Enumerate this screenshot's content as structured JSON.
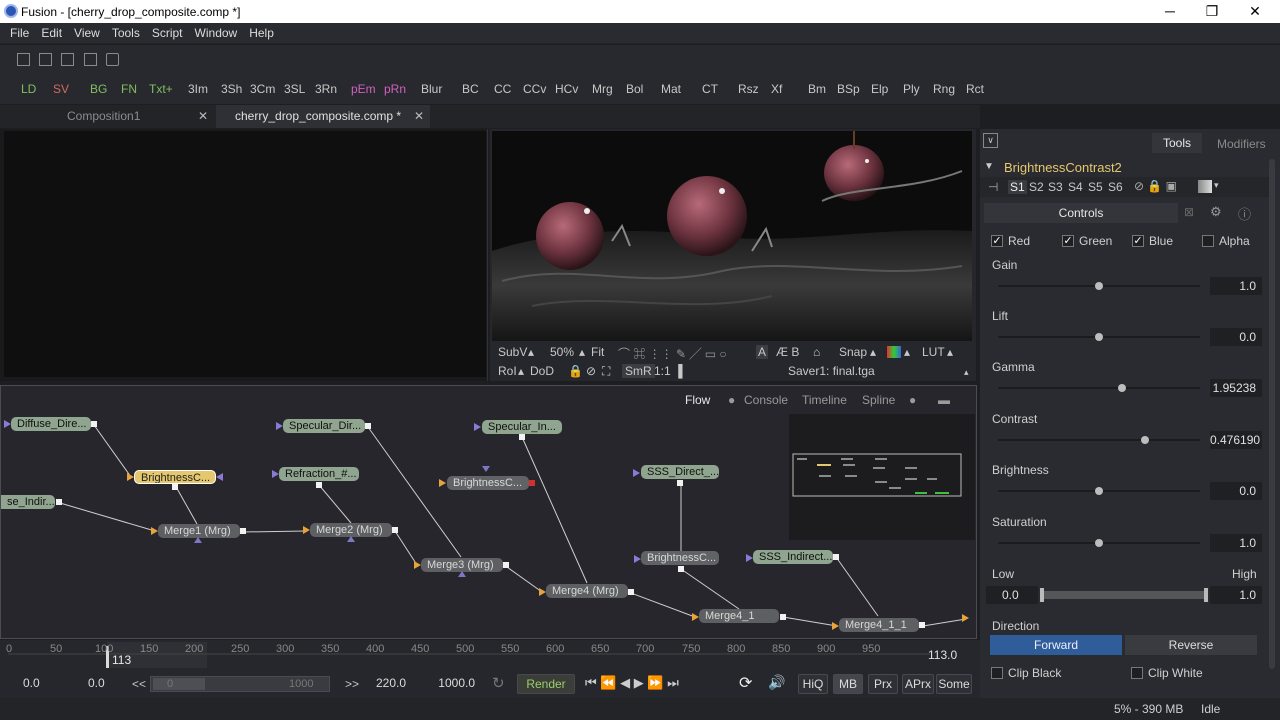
{
  "window": {
    "app": "Fusion",
    "title": "Fusion - [cherry_drop_composite.comp *]",
    "minimize": "─",
    "maximize": "❐",
    "close": "✕"
  },
  "menu": [
    "File",
    "Edit",
    "View",
    "Tools",
    "Script",
    "Window",
    "Help"
  ],
  "toolbar": {
    "items": [
      {
        "label": "LD",
        "color": "#7fbf5f"
      },
      {
        "label": "SV",
        "color": "#d06a5a"
      },
      {
        "label": "BG",
        "color": "#7fbf5f"
      },
      {
        "label": "FN",
        "color": "#7fbf5f"
      },
      {
        "label": "Txt+",
        "color": "#7fbf5f"
      },
      {
        "label": "3Im",
        "color": "#c8c8c8"
      },
      {
        "label": "3Sh",
        "color": "#c8c8c8"
      },
      {
        "label": "3Cm",
        "color": "#c8c8c8"
      },
      {
        "label": "3SL",
        "color": "#c8c8c8"
      },
      {
        "label": "3Rn",
        "color": "#c8c8c8"
      },
      {
        "label": "pEm",
        "color": "#d060c0"
      },
      {
        "label": "pRn",
        "color": "#d060c0"
      },
      {
        "label": "Blur",
        "color": "#c8c8c8"
      },
      {
        "label": "BC",
        "color": "#c8c8c8"
      },
      {
        "label": "CC",
        "color": "#c8c8c8"
      },
      {
        "label": "CCv",
        "color": "#c8c8c8"
      },
      {
        "label": "HCv",
        "color": "#c8c8c8"
      },
      {
        "label": "Mrg",
        "color": "#c8c8c8"
      },
      {
        "label": "Bol",
        "color": "#c8c8c8"
      },
      {
        "label": "Mat",
        "color": "#c8c8c8"
      },
      {
        "label": "CT",
        "color": "#c8c8c8"
      },
      {
        "label": "Rsz",
        "color": "#c8c8c8"
      },
      {
        "label": "Xf",
        "color": "#c8c8c8"
      },
      {
        "label": "Bm",
        "color": "#c8c8c8"
      },
      {
        "label": "BSp",
        "color": "#c8c8c8"
      },
      {
        "label": "Elp",
        "color": "#c8c8c8"
      },
      {
        "label": "Ply",
        "color": "#c8c8c8"
      },
      {
        "label": "Rng",
        "color": "#c8c8c8"
      },
      {
        "label": "Rct",
        "color": "#c8c8c8"
      }
    ]
  },
  "comp_tabs": [
    {
      "label": "Composition1",
      "active": false
    },
    {
      "label": "cherry_drop_composite.comp *",
      "active": true
    }
  ],
  "viewer": {
    "row1": {
      "subv": "SubV",
      "zoom": "50%",
      "fit": "Fit",
      "snap": "Snap",
      "lut": "LUT"
    },
    "row2": {
      "roi": "RoI",
      "dod": "DoD",
      "smr": "SmR",
      "ratio": "1:1",
      "saver": "Saver1: final.tga"
    }
  },
  "node_tabs": [
    "Flow",
    "Console",
    "Timeline",
    "Spline"
  ],
  "nodes": [
    {
      "label": "Diffuse_Dire..."
    },
    {
      "label": "BrightnessC..."
    },
    {
      "label": "se_Indir..."
    },
    {
      "label": "Merge1 (Mrg)"
    },
    {
      "label": "Specular_Dir..."
    },
    {
      "label": "Refraction_#..."
    },
    {
      "label": "Merge2 (Mrg)"
    },
    {
      "label": "Specular_In..."
    },
    {
      "label": "BrightnessC..."
    },
    {
      "label": "Merge3 (Mrg)"
    },
    {
      "label": "Merge4 (Mrg)"
    },
    {
      "label": "SSS_Direct_..."
    },
    {
      "label": "BrightnessC..."
    },
    {
      "label": "SSS_Indirect..."
    },
    {
      "label": "Merge4_1"
    },
    {
      "label": "Merge4_1_1"
    }
  ],
  "timeline": {
    "ticks": [
      "0",
      "50",
      "100",
      "150",
      "200",
      "250",
      "300",
      "350",
      "400",
      "450",
      "500",
      "550",
      "600",
      "650",
      "700",
      "750",
      "800",
      "850",
      "900",
      "950"
    ],
    "current": "113",
    "end": "113.0"
  },
  "transport": {
    "global_start": "0.0",
    "render_start": "0.0",
    "back": "<<",
    "range_start": "0",
    "range_end": "1000",
    "fwd": ">>",
    "render_end": "220.0",
    "global_end": "1000.0",
    "render": "Render",
    "hiq": "HiQ",
    "mb": "MB",
    "prx": "Prx",
    "aprx": "APrx",
    "some": "Some"
  },
  "inspector": {
    "tabs": [
      "Tools",
      "Modifiers"
    ],
    "tool_name": "BrightnessContrast2",
    "slots": [
      "S1",
      "S2",
      "S3",
      "S4",
      "S5",
      "S6"
    ],
    "section": "Controls",
    "channels": [
      {
        "label": "Red",
        "checked": true
      },
      {
        "label": "Green",
        "checked": true
      },
      {
        "label": "Blue",
        "checked": true
      },
      {
        "label": "Alpha",
        "checked": false
      }
    ],
    "sliders": [
      {
        "label": "Gain",
        "value": "1.0"
      },
      {
        "label": "Lift",
        "value": "0.0"
      },
      {
        "label": "Gamma",
        "value": "1.95238"
      },
      {
        "label": "Contrast",
        "value": "0.476190"
      },
      {
        "label": "Brightness",
        "value": "0.0"
      },
      {
        "label": "Saturation",
        "value": "1.0"
      }
    ],
    "low_high": {
      "low_label": "Low",
      "high_label": "High",
      "low": "0.0",
      "high": "1.0"
    },
    "direction": {
      "label": "Direction",
      "forward": "Forward",
      "reverse": "Reverse"
    },
    "clip": {
      "black": "Clip Black",
      "white": "Clip White"
    }
  },
  "status": {
    "memory": "5% - 390 MB",
    "state": "Idle"
  }
}
